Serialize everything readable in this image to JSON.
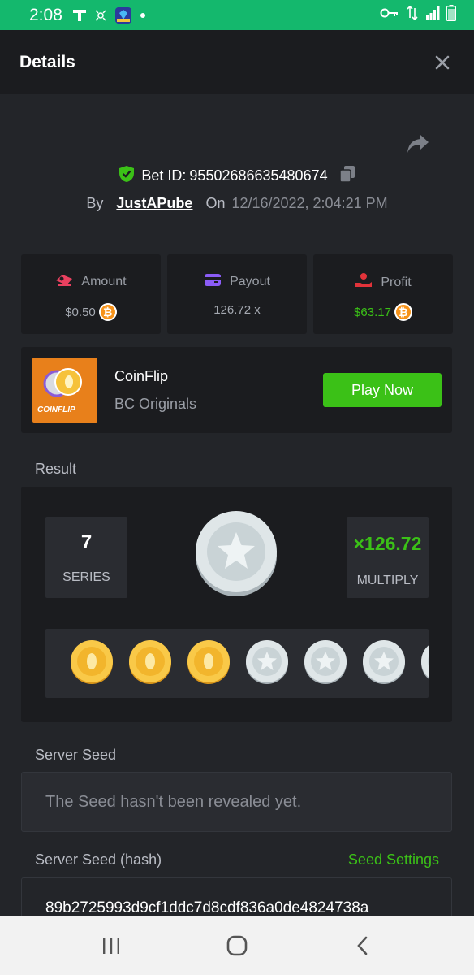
{
  "status_bar": {
    "time": "2:08",
    "left_icons": [
      "t-mobile-icon",
      "network-icon",
      "game-app-icon",
      "dot-icon"
    ],
    "right_icons": [
      "vpn-key-icon",
      "data-transfer-icon",
      "signal-icon",
      "battery-icon"
    ]
  },
  "header": {
    "title": "Details"
  },
  "bet": {
    "id_label": "Bet ID:",
    "id_value": "95502686635480674",
    "by_label": "By",
    "user": "JustAPube",
    "on_label": "On",
    "date": "12/16/2022, 2:04:21 PM"
  },
  "stats": [
    {
      "label": "Amount",
      "value": "$0.50",
      "icon": "amount-icon",
      "color": "#e9405f",
      "show_coin": true
    },
    {
      "label": "Payout",
      "value": "126.72 x",
      "icon": "payout-card-icon",
      "color": "#8b5cf6",
      "show_coin": false
    },
    {
      "label": "Profit",
      "value": "$63.17",
      "icon": "profit-hand-icon",
      "color": "#e2333a",
      "value_color": "#3bc117",
      "show_coin": true
    }
  ],
  "game": {
    "thumb_label": "COINFLIP",
    "name": "CoinFlip",
    "provider": "BC Originals",
    "play_label": "Play Now"
  },
  "result": {
    "section_label": "Result",
    "series_value": "7",
    "series_label": "SERIES",
    "multiply_value": "×126.72",
    "multiply_label": "MULTIPLY",
    "coins": [
      "gold",
      "gold",
      "gold",
      "silver",
      "silver",
      "silver",
      "silver"
    ]
  },
  "server_seed": {
    "label": "Server Seed",
    "value": "The Seed hasn't been revealed yet."
  },
  "server_seed_hash": {
    "label": "Server Seed (hash)",
    "settings_label": "Seed Settings",
    "value": "89b2725993d9cf1ddc7d8cdf836a0de4824738a"
  },
  "colors": {
    "status_bar": "#14b86d",
    "accent_green": "#3bc117",
    "bitcoin": "#f7931a",
    "panel": "#1b1c1f",
    "background": "#232529"
  }
}
